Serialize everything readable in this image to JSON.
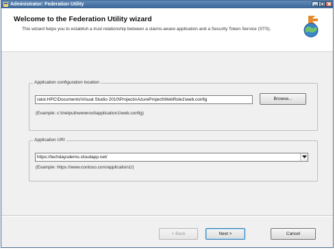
{
  "window": {
    "title": "Administrator: Federation Utility"
  },
  "header": {
    "title": "Welcome to the Federation Utility wizard",
    "description": "This wizard helps you to establish a trust relationship between a claims-aware application and a Security Token Service (STS)."
  },
  "app_config": {
    "legend": "Application configuration location",
    "value": "rator.HPC\\Documents\\Visual Studio 2010\\Projects\\AzureProject\\WebRole1\\web.config",
    "browse_label": "Browse...",
    "example": "(Example: c:\\inetpub\\wwwroot\\application1\\web.config)"
  },
  "app_uri": {
    "legend": "Application URI",
    "value": "https://techdaysdemo.cloudapp.net/",
    "example": "(Example: https://www.contoso.com/application1/)"
  },
  "footer": {
    "back_label": "< Back",
    "next_label": "Next >",
    "cancel_label": "Cancel"
  },
  "icons": [
    "window-app-icon",
    "minimize-icon",
    "maximize-icon",
    "close-icon",
    "wizard-globe-icon",
    "dropdown-arrow-icon"
  ],
  "colors": {
    "titlebar": "#3b6597",
    "header_bg": "#ffffff",
    "body_bg": "#f0f0f0"
  }
}
